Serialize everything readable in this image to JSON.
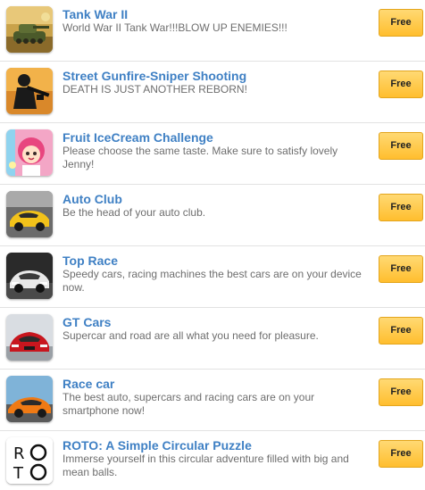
{
  "apps": [
    {
      "icon": "tank-icon",
      "title": "Tank War II",
      "description": "World War II Tank War!!!BLOW UP ENEMIES!!!",
      "price": "Free"
    },
    {
      "icon": "sniper-icon",
      "title": "Street Gunfire-Sniper Shooting",
      "description": "DEATH IS JUST ANOTHER REBORN!",
      "price": "Free"
    },
    {
      "icon": "icecream-girl-icon",
      "title": "Fruit IceCream Challenge",
      "description": "Please choose the same taste. Make sure to satisfy lovely Jenny!",
      "price": "Free"
    },
    {
      "icon": "yellow-car-icon",
      "title": "Auto Club",
      "description": "Be the head of your auto club.",
      "price": "Free"
    },
    {
      "icon": "white-car-icon",
      "title": "Top Race",
      "description": "Speedy cars, racing machines the best cars are on your device now.",
      "price": "Free"
    },
    {
      "icon": "red-car-icon",
      "title": "GT Cars",
      "description": "Supercar and road are all what you need for pleasure.",
      "price": "Free"
    },
    {
      "icon": "orange-car-icon",
      "title": "Race car",
      "description": "The best auto, supercars and racing cars are on your smartphone now!",
      "price": "Free"
    },
    {
      "icon": "roto-logo-icon",
      "title": "ROTO: A Simple Circular Puzzle",
      "description": "Immerse yourself in this circular adventure filled with big and mean balls.",
      "price": "Free"
    }
  ],
  "colors": {
    "title": "#3f80c4",
    "description": "#6e6e6e",
    "button_top": "#ffd973",
    "button_bottom": "#ffbe2e",
    "divider": "#e2e2e2"
  }
}
